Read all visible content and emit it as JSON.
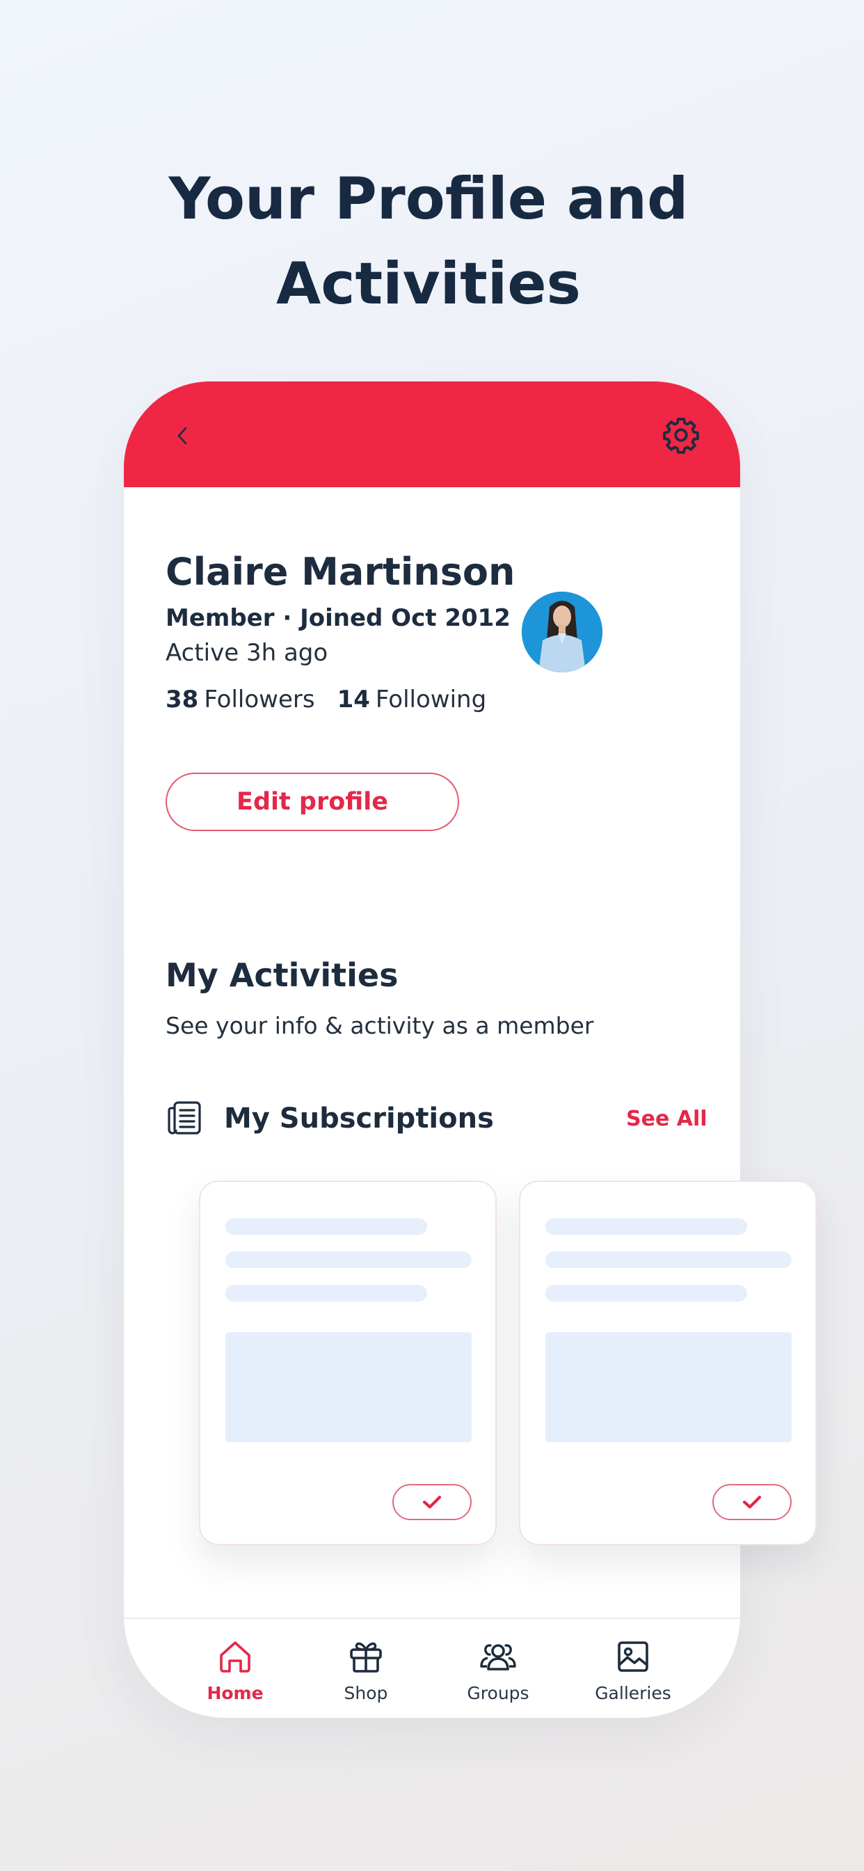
{
  "headline": {
    "line1": "Your Profile and",
    "line2": "Activities"
  },
  "header": {
    "back_icon": "chevron-left-icon",
    "settings_icon": "gear-icon",
    "color": "#ef2745"
  },
  "profile": {
    "name": "Claire Martinson",
    "member_line": "Member · Joined Oct 2012",
    "active": "Active 3h ago",
    "followers_count": "38",
    "followers_label": "Followers",
    "following_count": "14",
    "following_label": "Following",
    "edit_button": "Edit profile"
  },
  "activities": {
    "title": "My Activities",
    "subtitle": "See your info & activity as a member",
    "subscriptions_title": "My Subscriptions",
    "see_all": "See All",
    "subscriptions_icon": "newspaper-icon"
  },
  "nav": {
    "items": [
      {
        "label": "Home",
        "icon": "home-icon",
        "active": true
      },
      {
        "label": "Shop",
        "icon": "gift-icon",
        "active": false
      },
      {
        "label": "Groups",
        "icon": "users-icon",
        "active": false
      },
      {
        "label": "Galleries",
        "icon": "image-icon",
        "active": false
      }
    ]
  },
  "colors": {
    "accent": "#e3284a",
    "text": "#1d2c3e",
    "skeleton": "#e6effb"
  }
}
